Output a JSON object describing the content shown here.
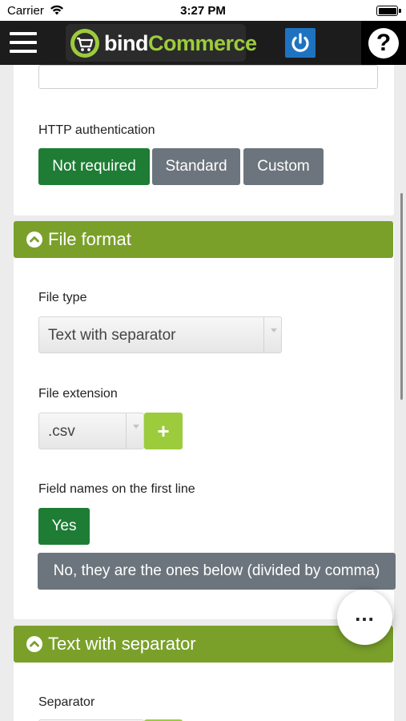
{
  "status_bar": {
    "carrier": "Carrier",
    "time": "3:27 PM"
  },
  "header": {
    "logo_bind": "bind",
    "logo_commerce": "Commerce",
    "help_symbol": "?",
    "menu_icon": "hamburger-icon",
    "power_icon": "power-icon",
    "colors": {
      "brand_green": "#9ccc3b",
      "power_blue": "#1e73c1"
    }
  },
  "http_auth": {
    "label": "HTTP authentication",
    "options": [
      "Not required",
      "Standard",
      "Custom"
    ],
    "selected": "Not required"
  },
  "file_format": {
    "title": "File format",
    "file_type_label": "File type",
    "file_type_value": "Text with separator",
    "file_extension_label": "File extension",
    "file_extension_value": ".csv",
    "add_symbol": "+",
    "field_names_label": "Field names on the first line",
    "field_names_yes": "Yes",
    "field_names_no": "No, they are the ones below (divided by comma)",
    "selected": "Yes"
  },
  "text_separator": {
    "title": "Text with separator",
    "separator_label": "Separator"
  },
  "fab": {
    "label": "..."
  },
  "colors": {
    "selected_green": "#1e7c34",
    "unselected_gray": "#6c757d",
    "section_header": "#7aa02a"
  }
}
